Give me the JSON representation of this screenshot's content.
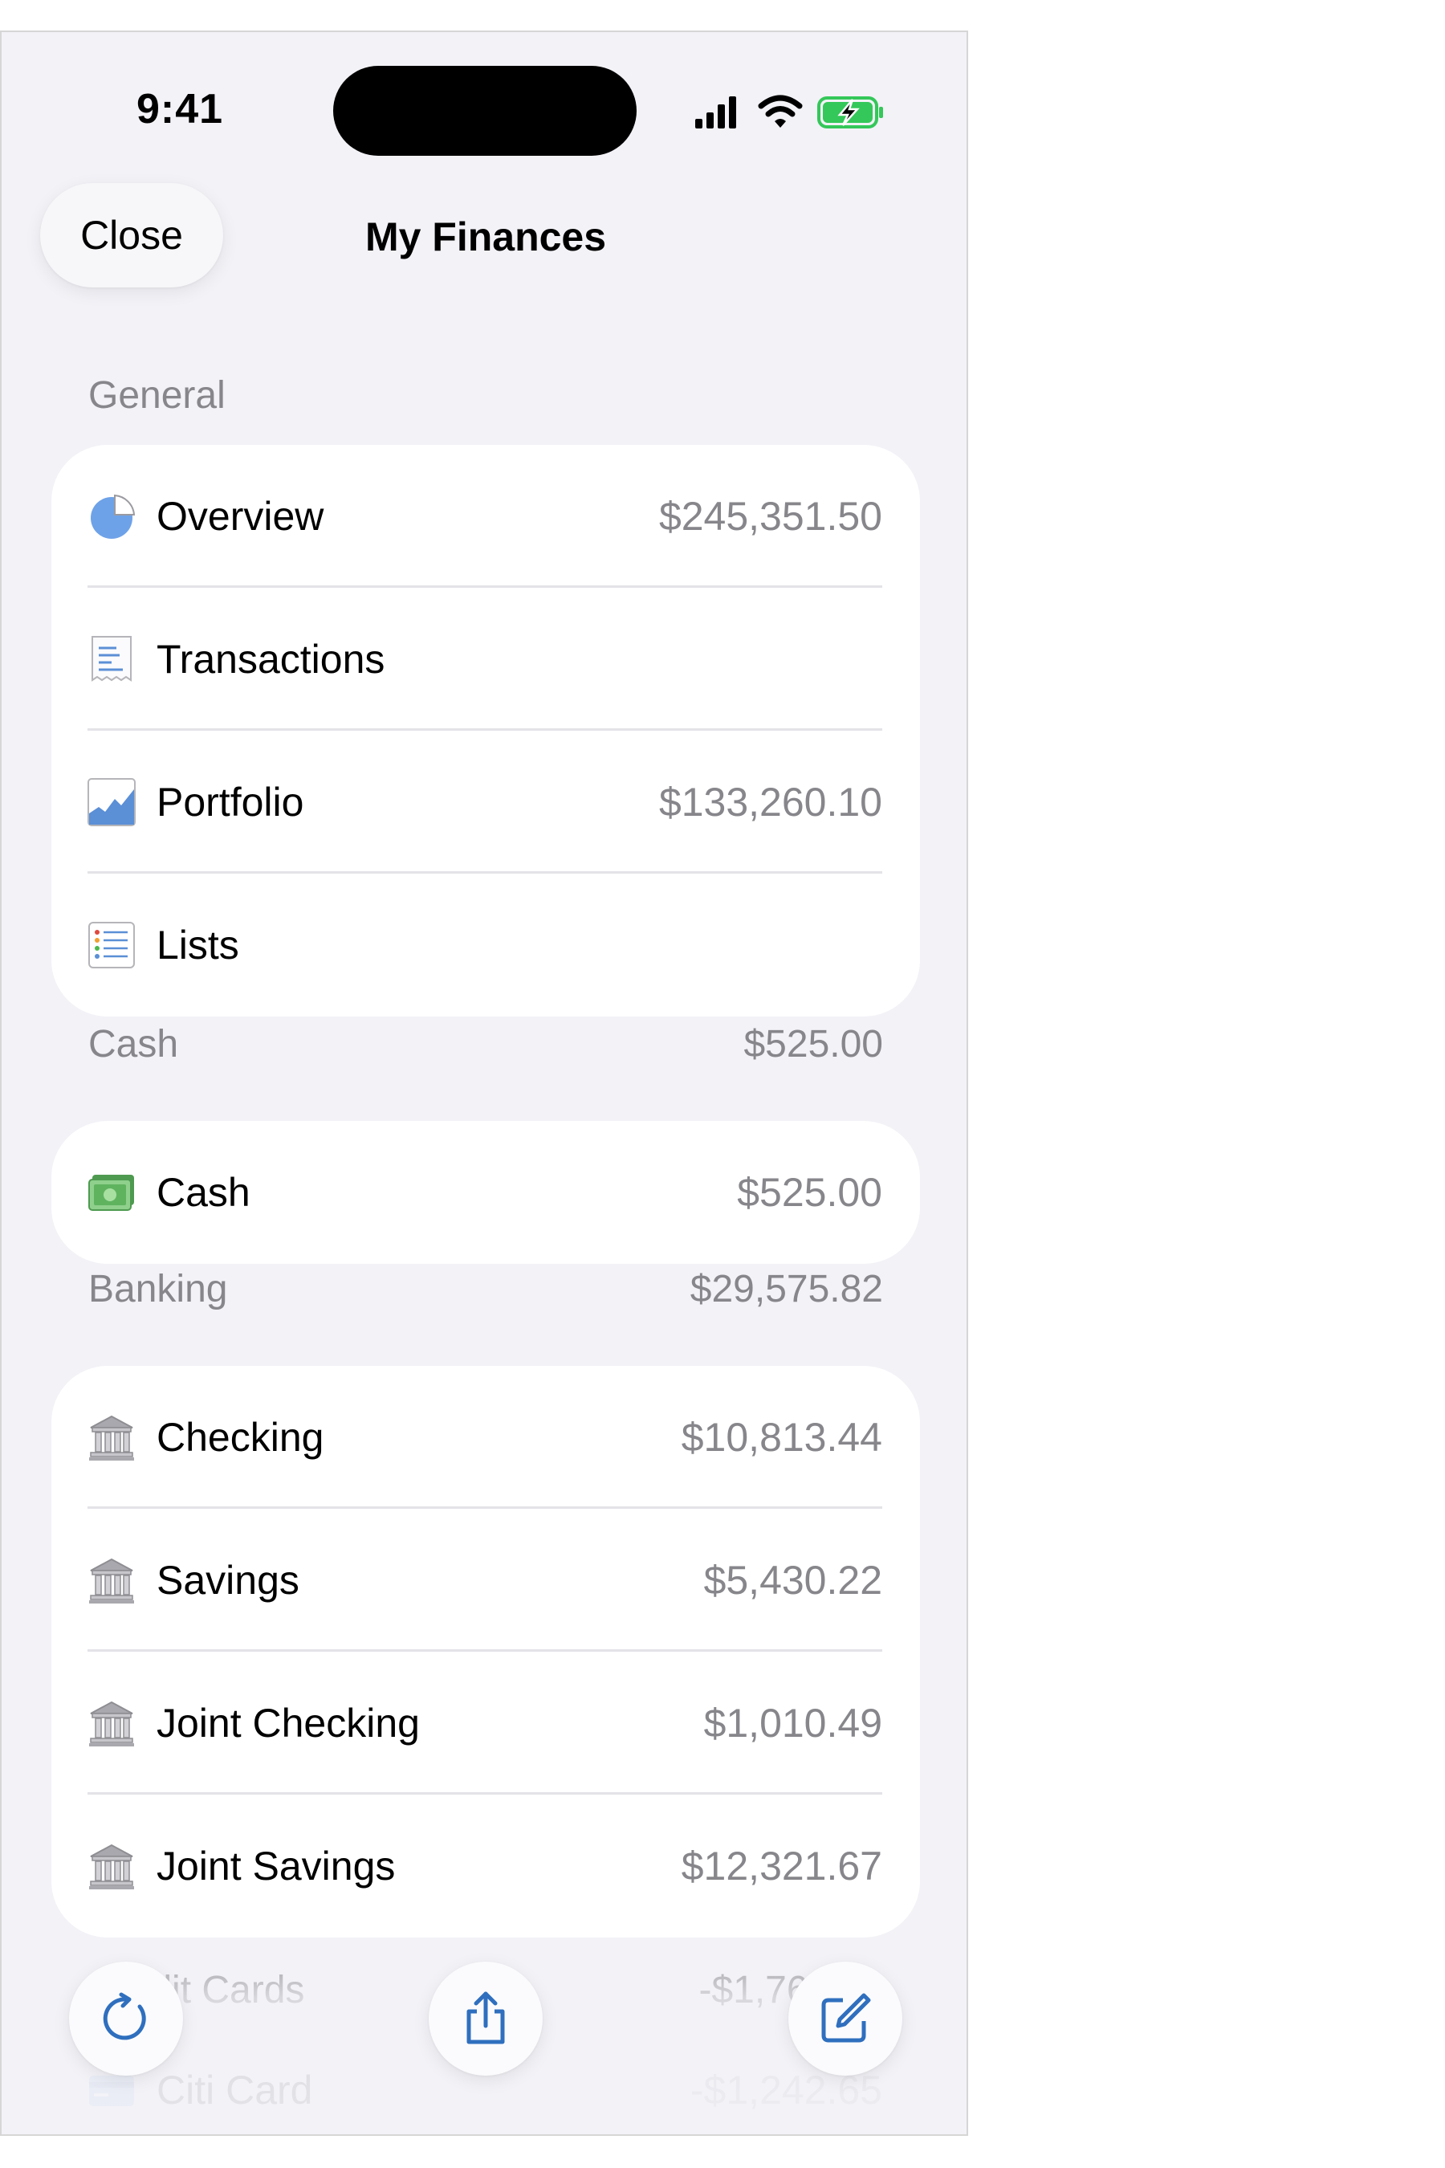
{
  "status_bar": {
    "time": "9:41"
  },
  "nav": {
    "close_label": "Close",
    "title": "My Finances"
  },
  "sections": {
    "general": {
      "header": "General",
      "rows": [
        {
          "label": "Overview",
          "value": "$245,351.50",
          "icon": "pie-chart-icon"
        },
        {
          "label": "Transactions",
          "value": "",
          "icon": "receipt-icon"
        },
        {
          "label": "Portfolio",
          "value": "$133,260.10",
          "icon": "area-chart-icon"
        },
        {
          "label": "Lists",
          "value": "",
          "icon": "list-icon"
        }
      ]
    },
    "cash": {
      "header": "Cash",
      "total": "$525.00",
      "rows": [
        {
          "label": "Cash",
          "value": "$525.00",
          "icon": "banknote-icon"
        }
      ]
    },
    "banking": {
      "header": "Banking",
      "total": "$29,575.82",
      "rows": [
        {
          "label": "Checking",
          "value": "$10,813.44",
          "icon": "bank-icon"
        },
        {
          "label": "Savings",
          "value": "$5,430.22",
          "icon": "bank-icon"
        },
        {
          "label": "Joint Checking",
          "value": "$1,010.49",
          "icon": "bank-icon"
        },
        {
          "label": "Joint Savings",
          "value": "$12,321.67",
          "icon": "bank-icon"
        }
      ]
    },
    "credit_cards": {
      "header": "Credit Cards",
      "total": "-$1,766.09",
      "rows": [
        {
          "label": "Citi Card",
          "value": "-$1,242.65",
          "icon": "credit-card-icon"
        }
      ]
    }
  },
  "toolbar": {
    "refresh": "refresh-icon",
    "share": "share-icon",
    "compose": "compose-icon"
  },
  "colors": {
    "background": "#f2f2f7",
    "card": "#ffffff",
    "secondary_text": "#86868b",
    "accent": "#2f6fbe",
    "battery_green": "#34c759"
  }
}
